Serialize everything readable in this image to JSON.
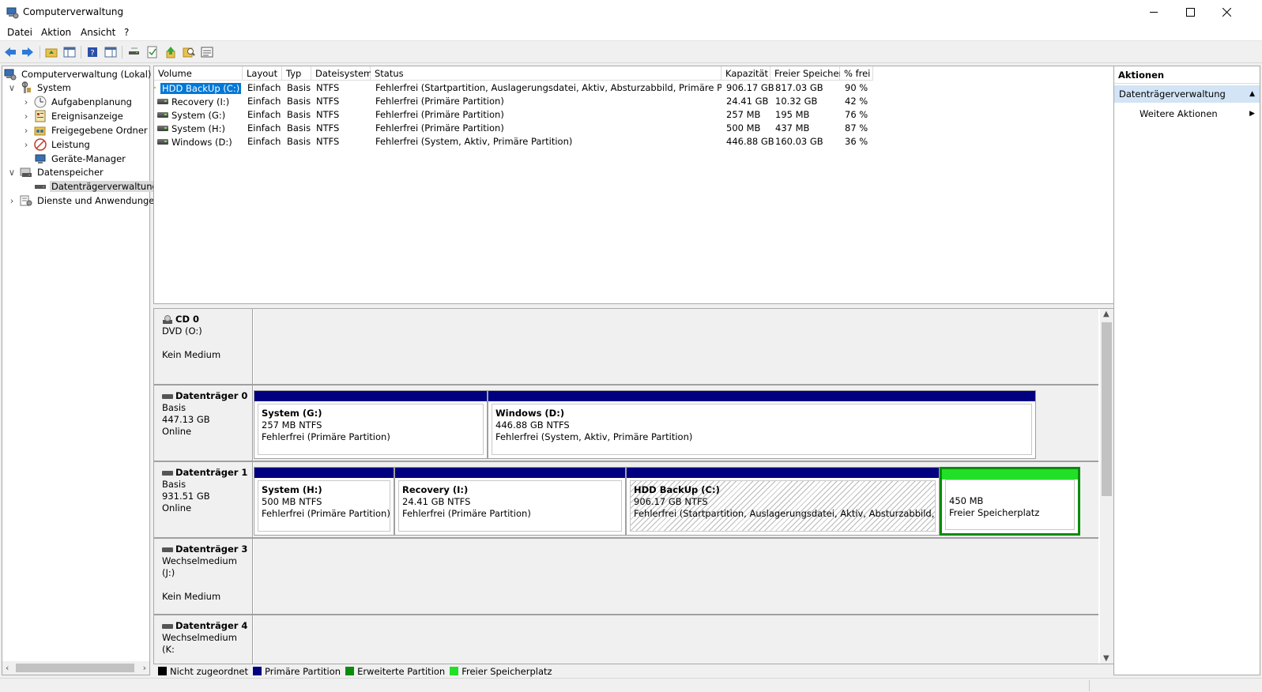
{
  "window": {
    "title": "Computerverwaltung",
    "icon": "computer-management-icon"
  },
  "menu": [
    "Datei",
    "Aktion",
    "Ansicht",
    "?"
  ],
  "toolbar_icons": [
    "back-arrow-icon",
    "forward-arrow-icon",
    "up-folder-icon",
    "show-hide-console-tree-icon",
    "help-icon",
    "show-hide-action-pane-icon",
    "connect-drive-icon",
    "checklist-icon",
    "up-arrow-icon",
    "search-icon",
    "properties-icon"
  ],
  "tree": {
    "root": "Computerverwaltung (Lokal)",
    "system": "System",
    "system_items": [
      "Aufgabenplanung",
      "Ereignisanzeige",
      "Freigegebene Ordner",
      "Leistung",
      "Geräte-Manager"
    ],
    "storage": "Datenspeicher",
    "storage_items": [
      "Datenträgerverwaltung"
    ],
    "services": "Dienste und Anwendungen"
  },
  "volumes": {
    "headers": [
      "Volume",
      "Layout",
      "Typ",
      "Dateisystem",
      "Status",
      "Kapazität",
      "Freier Speicher",
      "% frei"
    ],
    "rows": [
      [
        "HDD BackUp (C:)",
        "Einfach",
        "Basis",
        "NTFS",
        "Fehlerfrei (Startpartition, Auslagerungsdatei, Aktiv, Absturzabbild, Primäre Partition)",
        "906.17 GB",
        "817.03 GB",
        "90 %"
      ],
      [
        "Recovery (I:)",
        "Einfach",
        "Basis",
        "NTFS",
        "Fehlerfrei (Primäre Partition)",
        "24.41 GB",
        "10.32 GB",
        "42 %"
      ],
      [
        "System (G:)",
        "Einfach",
        "Basis",
        "NTFS",
        "Fehlerfrei (Primäre Partition)",
        "257 MB",
        "195 MB",
        "76 %"
      ],
      [
        "System (H:)",
        "Einfach",
        "Basis",
        "NTFS",
        "Fehlerfrei (Primäre Partition)",
        "500 MB",
        "437 MB",
        "87 %"
      ],
      [
        "Windows (D:)",
        "Einfach",
        "Basis",
        "NTFS",
        "Fehlerfrei (System, Aktiv, Primäre Partition)",
        "446.88 GB",
        "160.03 GB",
        "36 %"
      ]
    ]
  },
  "disks": [
    {
      "name": "CD 0",
      "line1": "DVD (O:)",
      "line2": "",
      "line3": "Kein Medium",
      "partitions": []
    },
    {
      "name": "Datenträger 0",
      "line1": "Basis",
      "line2": "447.13 GB",
      "line3": "Online",
      "partitions": [
        {
          "name": "System  (G:)",
          "size": "257 MB NTFS",
          "status": "Fehlerfrei (Primäre Partition)"
        },
        {
          "name": "Windows  (D:)",
          "size": "446.88 GB NTFS",
          "status": "Fehlerfrei (System, Aktiv, Primäre Partition)"
        }
      ]
    },
    {
      "name": "Datenträger 1",
      "line1": "Basis",
      "line2": "931.51 GB",
      "line3": "Online",
      "partitions": [
        {
          "name": "System  (H:)",
          "size": "500 MB NTFS",
          "status": "Fehlerfrei (Primäre Partition)"
        },
        {
          "name": "Recovery  (I:)",
          "size": "24.41 GB NTFS",
          "status": "Fehlerfrei (Primäre Partition)"
        },
        {
          "name": "HDD BackUp  (C:)",
          "size": "906.17 GB NTFS",
          "status": "Fehlerfrei (Startpartition, Auslagerungsdatei, Aktiv, Absturzabbild, Primäre"
        },
        {
          "name": "",
          "size": "450 MB",
          "status": "Freier Speicherplatz"
        }
      ]
    },
    {
      "name": "Datenträger 3",
      "line1": "Wechselmedium (J:)",
      "line2": "",
      "line3": "Kein Medium",
      "partitions": []
    },
    {
      "name": "Datenträger 4",
      "line1": "Wechselmedium (K:",
      "line2": "",
      "line3": "",
      "partitions": []
    }
  ],
  "legend": [
    {
      "label": "Nicht zugeordnet",
      "color": "#000000"
    },
    {
      "label": "Primäre Partition",
      "color": "#000080"
    },
    {
      "label": "Erweiterte Partition",
      "color": "#0a8c0a"
    },
    {
      "label": "Freier Speicherplatz",
      "color": "#22e028"
    }
  ],
  "actions": {
    "header": "Aktionen",
    "section": "Datenträgerverwaltung",
    "item": "Weitere Aktionen"
  }
}
